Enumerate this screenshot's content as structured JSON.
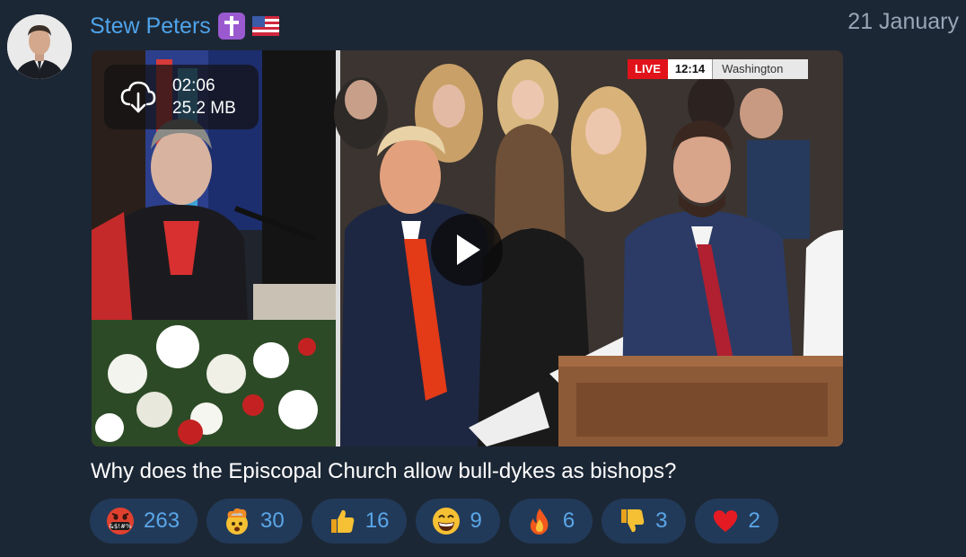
{
  "author": {
    "name": "Stew Peters",
    "badge_icon": "latin-cross-icon",
    "flag_icon": "us-flag-icon"
  },
  "date": "21 January",
  "media": {
    "duration": "02:06",
    "size": "25.2 MB",
    "live_label": "LIVE",
    "live_time": "12:14",
    "live_location": "Washington"
  },
  "caption": "Why does the Episcopal Church allow bull-dykes as bishops?",
  "reactions": [
    {
      "icon": "cursing-face-icon",
      "count": "263"
    },
    {
      "icon": "exploding-head-icon",
      "count": "30"
    },
    {
      "icon": "thumbs-up-icon",
      "count": "16"
    },
    {
      "icon": "grinning-face-icon",
      "count": "9"
    },
    {
      "icon": "fire-icon",
      "count": "6"
    },
    {
      "icon": "thumbs-down-icon",
      "count": "3"
    },
    {
      "icon": "red-heart-icon",
      "count": "2"
    }
  ],
  "colors": {
    "background": "#1c2735",
    "accent": "#4fa3ea",
    "reaction_bg": "#223a59"
  }
}
